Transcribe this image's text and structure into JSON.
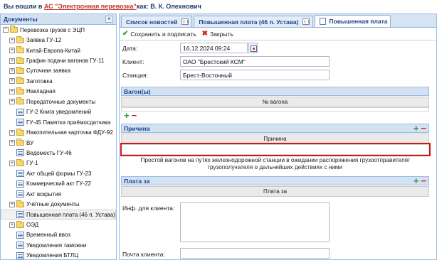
{
  "banner": {
    "prefix": "Вы вошли в ",
    "system": "АС \"Электронная перевозка\"",
    "suffix": " как: В. К. Олехнович"
  },
  "sidebar": {
    "title": "Документы",
    "collapse_glyph": "«",
    "root": {
      "label": "Перевозка грузов с ЭЦП",
      "expanded_glyph": "−"
    },
    "items": [
      {
        "label": "Заявка ГУ-12",
        "type": "folder"
      },
      {
        "label": "Китай-Европа-Китай",
        "type": "folder"
      },
      {
        "label": "График подачи вагонов ГУ-11",
        "type": "folder"
      },
      {
        "label": "Суточная заявка",
        "type": "folder"
      },
      {
        "label": "Заготовка",
        "type": "folder"
      },
      {
        "label": "Накладная",
        "type": "folder"
      },
      {
        "label": "Передаточные документы",
        "type": "folder"
      },
      {
        "label": "ГУ-2 Книга уведомлений",
        "type": "doc"
      },
      {
        "label": "ГУ-45 Памятка приёмосдатчика",
        "type": "doc"
      },
      {
        "label": "Накопительная карточка ФДУ-92",
        "type": "folder"
      },
      {
        "label": "ВУ",
        "type": "folder"
      },
      {
        "label": "Ведомость ГУ-46",
        "type": "doc"
      },
      {
        "label": "ГУ-1",
        "type": "folder"
      },
      {
        "label": "Акт общей формы ГУ-23",
        "type": "doc"
      },
      {
        "label": "Коммерческий акт ГУ-22",
        "type": "doc"
      },
      {
        "label": "Акт вскрытия",
        "type": "doc"
      },
      {
        "label": "Учётные документы",
        "type": "folder"
      },
      {
        "label": "Повышенная плата (46 п. Устава)",
        "type": "doc",
        "selected": true
      },
      {
        "label": "ОЭД",
        "type": "folder"
      },
      {
        "label": "Временный ввоз",
        "type": "doc"
      },
      {
        "label": "Уведомления таможни",
        "type": "doc"
      },
      {
        "label": "Уведомления БТЛЦ",
        "type": "doc"
      }
    ]
  },
  "tabs": [
    {
      "label": "Список новостей"
    },
    {
      "label": "Повышенная плата (46 п. Устава)"
    },
    {
      "label": "Повышенная плата",
      "active": true
    }
  ],
  "toolbar": {
    "save_label": "Сохранить и подписать",
    "close_label": "Закрыть"
  },
  "form": {
    "date_label": "Дата:",
    "date_value": "16.12.2024 09:24",
    "client_label": "Клиент:",
    "client_value": "ОАО \"Брестский КСМ\"",
    "station_label": "Станция:",
    "station_value": "Брест-Восточный"
  },
  "wagons": {
    "title": "Вагон(ы)",
    "column": "№ вагона"
  },
  "reason": {
    "title": "Причина",
    "column": "Причина",
    "note_line1": "Простой вагонов на путях железнодорожной станции в ожидании распоряжения грузоотправителя/",
    "note_line2": "грузополучателя о дальнейших действиях с ними"
  },
  "payment": {
    "title": "Плата за",
    "column": "Плата за"
  },
  "client_info": {
    "info_label": "Инф. для клиента:",
    "email_label": "Почта клиента:"
  },
  "colors": {
    "accent": "#15428b",
    "panel_header": "#d3e1f1",
    "highlight_border": "#d01818",
    "add": "#2a9a2a",
    "remove": "#d42020"
  }
}
